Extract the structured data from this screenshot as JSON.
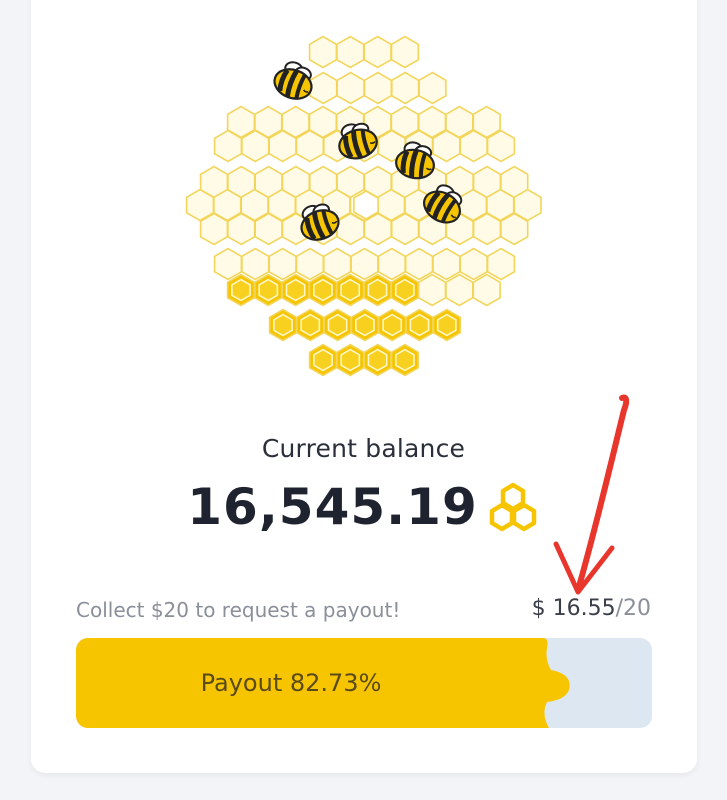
{
  "balance": {
    "label": "Current balance",
    "value": "16,545.19",
    "unit_icon": "honeycomb-icon"
  },
  "payout": {
    "hint": "Collect $20 to request a payout!",
    "current": "$ 16.55",
    "target": "/20",
    "button_label": "Payout 82.73%",
    "progress_fraction": 0.8273
  },
  "colors": {
    "accent": "#f6c500",
    "track": "#dde7f1",
    "annotation": "#e8362c"
  }
}
